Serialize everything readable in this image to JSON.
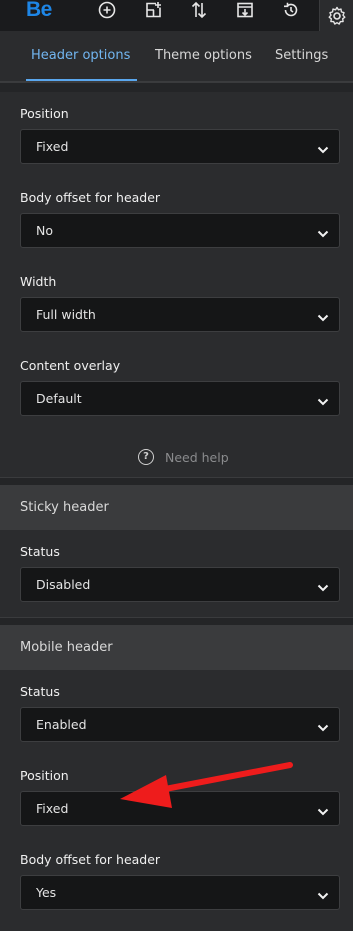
{
  "app": {
    "logo_text": "Be"
  },
  "toolbar": {
    "icons": [
      "plus-circle-icon",
      "add-layout-icon",
      "sort-arrows-icon",
      "import-icon",
      "history-icon",
      "gear-icon"
    ]
  },
  "tabs": [
    {
      "label": "Header options",
      "active": true
    },
    {
      "label": "Theme options",
      "active": false
    },
    {
      "label": "Settings",
      "active": false
    }
  ],
  "header_options": {
    "position": {
      "label": "Position",
      "value": "Fixed"
    },
    "body_offset": {
      "label": "Body offset for header",
      "value": "No"
    },
    "width": {
      "label": "Width",
      "value": "Full width"
    },
    "content_overlay": {
      "label": "Content overlay",
      "value": "Default"
    },
    "help_text": "Need help"
  },
  "sticky_header": {
    "title": "Sticky header",
    "status": {
      "label": "Status",
      "value": "Disabled"
    }
  },
  "mobile_header": {
    "title": "Mobile header",
    "status": {
      "label": "Status",
      "value": "Enabled"
    },
    "position": {
      "label": "Position",
      "value": "Fixed"
    },
    "body_offset": {
      "label": "Body offset for header",
      "value": "Yes"
    }
  },
  "colors": {
    "accent": "#1e86e6",
    "active_tab": "#72b6f1",
    "annotation_arrow": "#ee1c1c"
  }
}
